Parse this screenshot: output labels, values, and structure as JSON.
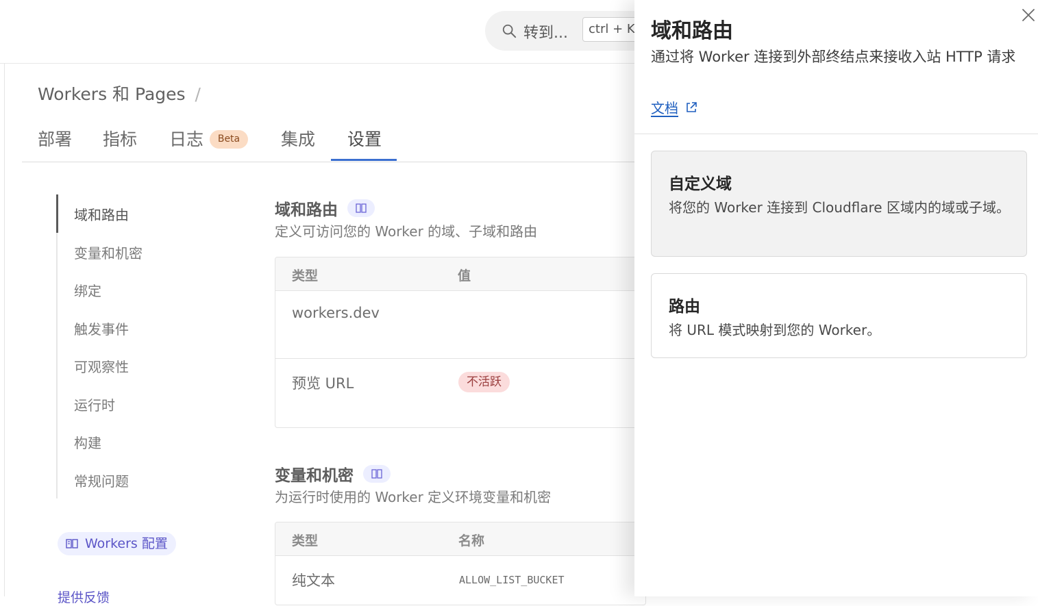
{
  "header": {
    "search_placeholder": "转到...",
    "shortcut": "ctrl + K"
  },
  "breadcrumb": {
    "item": "Workers 和 Pages",
    "separator": "/"
  },
  "tabs": [
    {
      "label": "部署"
    },
    {
      "label": "指标"
    },
    {
      "label": "日志",
      "badge": "Beta"
    },
    {
      "label": "集成"
    },
    {
      "label": "设置",
      "active": true
    }
  ],
  "sidenav": {
    "items": [
      "域和路由",
      "变量和机密",
      "绑定",
      "触发事件",
      "可观察性",
      "运行时",
      "构建",
      "常规问题"
    ],
    "active_index": 0,
    "workers_config": "Workers 配置",
    "feedback": "提供反馈"
  },
  "sections": {
    "domains": {
      "title": "域和路由",
      "desc": "定义可访问您的 Worker 的域、子域和路由",
      "columns": [
        "类型",
        "值"
      ],
      "rows": [
        {
          "type": "workers.dev",
          "value": ""
        },
        {
          "type": "预览 URL",
          "status": "不活跃"
        }
      ]
    },
    "variables": {
      "title": "变量和机密",
      "desc": "为运行时使用的 Worker 定义环境变量和机密",
      "columns": [
        "类型",
        "名称"
      ],
      "rows": [
        {
          "type": "纯文本",
          "name": "ALLOW_LIST_BUCKET"
        }
      ]
    }
  },
  "drawer": {
    "title": "域和路由",
    "desc": "通过将 Worker 连接到外部终结点来接收入站 HTTP 请求",
    "doc_link": "文档",
    "options": [
      {
        "title": "自定义域",
        "desc": "将您的 Worker 连接到 Cloudflare 区域内的域或子域。"
      },
      {
        "title": "路由",
        "desc": "将 URL 模式映射到您的 Worker。"
      }
    ]
  },
  "colors": {
    "accent": "#3b6fd0",
    "link": "#1f5fbf",
    "config_purple": "#5b55c7"
  }
}
